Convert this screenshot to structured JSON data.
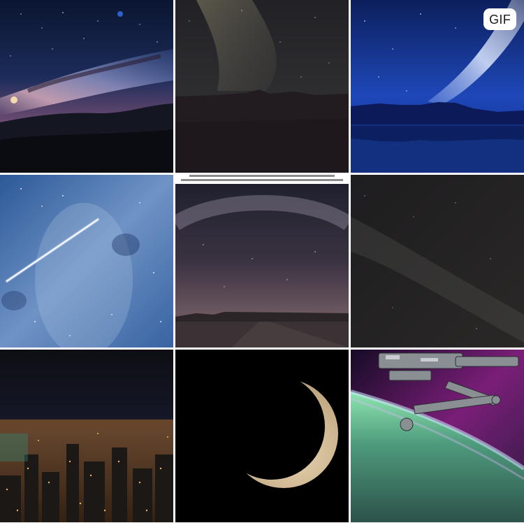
{
  "gallery": {
    "badges": {
      "gif": "GIF"
    },
    "items": [
      {
        "subject": "milky-way-over-mountain-ridge"
      },
      {
        "subject": "milky-way-over-forest-silhouette"
      },
      {
        "subject": "galaxy-over-lake-reflection",
        "badge": "GIF"
      },
      {
        "subject": "meteor-streak-blue-starfield"
      },
      {
        "subject": "milky-way-arc-over-desert-road",
        "stacked": true
      },
      {
        "subject": "faint-milky-way-dark-sky"
      },
      {
        "subject": "city-lights-night-skyline"
      },
      {
        "subject": "crescent-moon"
      },
      {
        "subject": "space-station-arm-over-aurora"
      }
    ]
  },
  "colors": {
    "background": "#ffffff",
    "badge_bg": "#ffffff",
    "badge_text": "#1a1a1a"
  }
}
